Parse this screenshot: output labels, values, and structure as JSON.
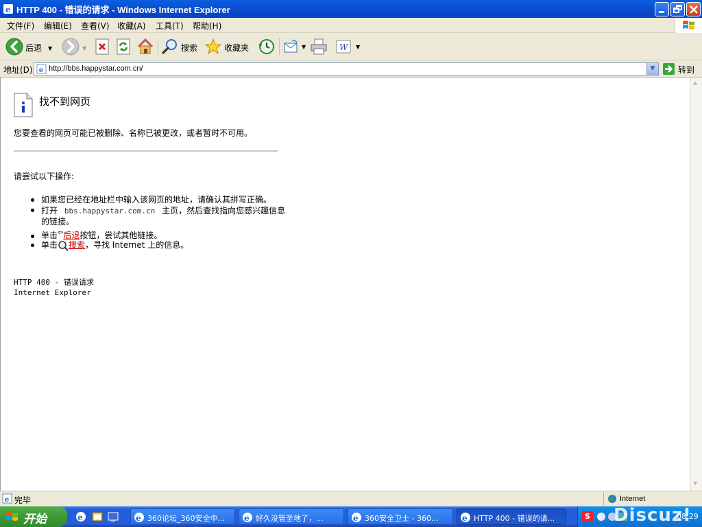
{
  "window": {
    "title": "HTTP 400 - 错误的请求 - Windows Internet Explorer"
  },
  "menu": {
    "items": [
      "文件(F)",
      "编辑(E)",
      "查看(V)",
      "收藏(A)",
      "工具(T)",
      "帮助(H)"
    ]
  },
  "toolbar": {
    "back_label": "后退",
    "search_label": "搜索",
    "favorites_label": "收藏夹"
  },
  "address": {
    "label": "地址(D)",
    "url": "http://bbs.happystar.com.cn/",
    "go_label": "转到"
  },
  "page": {
    "heading": "找不到网页",
    "intro": "您要查看的网页可能已被删除、名称已被更改，或者暂时不可用。",
    "try_label": "请尝试以下操作:",
    "tip1": "如果您已经在地址栏中输入该网页的地址，请确认其拼写正确。",
    "tip2_pre": "打开",
    "tip2_host": "bbs.happystar.com.cn",
    "tip2_post": "主页，然后查找指向您感兴趣信息",
    "tip2_line2": "的链接。",
    "tip3_pre": "单击",
    "tip3_link": "后退",
    "tip3_post": "按钮，尝试其他链接。",
    "tip4_pre": "单击",
    "tip4_link": "搜索",
    "tip4_post": "，寻找 Internet 上的信息。",
    "footer1": "HTTP 400 - 错误请求",
    "footer2": "Internet Explorer"
  },
  "status": {
    "text": "完毕",
    "zone": "Internet"
  },
  "taskbar": {
    "start_label": "开始",
    "tasks": [
      "360论坛_360安全中...",
      "好久没管圣地了，...",
      "360安全卫士 - 360...",
      "HTTP 400 - 错误的请..."
    ],
    "clock": "08:29",
    "watermark": "Discuz!"
  }
}
